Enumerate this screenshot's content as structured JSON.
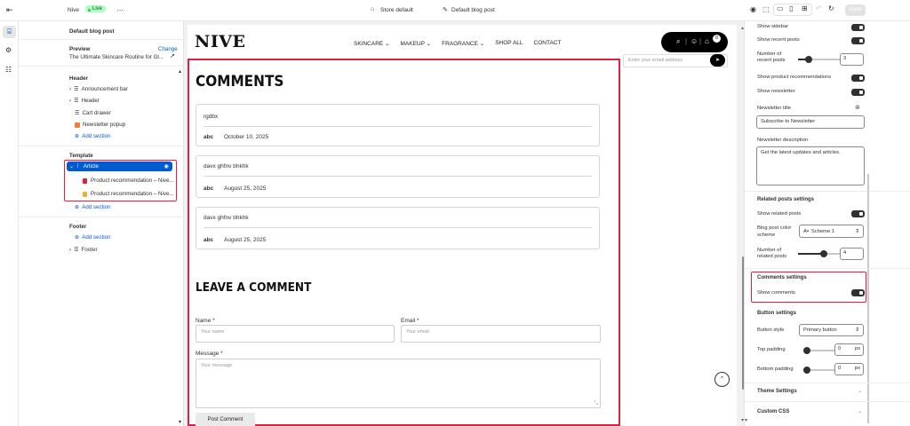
{
  "topbar": {
    "store_name": "Nive",
    "live_badge": "Live",
    "more": "…",
    "store_default": "Store default",
    "template_selector": "Default blog post",
    "save_label": "Save"
  },
  "sidebar": {
    "title": "Default blog post",
    "preview_label": "Preview",
    "change_label": "Change",
    "preview_item": "The Ultimate Skincare Routine for Gl...",
    "header_group": "Header",
    "header_items": [
      "Announcement bar",
      "Header",
      "Cart drawer",
      "Newsletter popup"
    ],
    "add_section": "Add section",
    "template_group": "Template",
    "article_label": "Article",
    "article_blocks": [
      "Product recommendation – Nive...",
      "Product recommendation – Nive..."
    ],
    "footer_group": "Footer",
    "footer_item": "Footer"
  },
  "preview": {
    "logo": "NIVE",
    "nav": [
      "SKINCARE",
      "MAKEUP",
      "FRAGRANCE",
      "SHOP ALL",
      "CONTACT"
    ],
    "cart_count": "0",
    "email_placeholder": "Enter your email address",
    "comments_heading": "COMMENTS",
    "comments": [
      {
        "text": "rgdbx",
        "author": "abc",
        "date": "October 10, 2025"
      },
      {
        "text": "davx ghfnv bhkhk",
        "author": "abc",
        "date": "August 25, 2025"
      },
      {
        "text": "davx ghfnv bhkhk",
        "author": "abc",
        "date": "August 25, 2025"
      }
    ],
    "leave_heading": "LEAVE A COMMENT",
    "name_label": "Name *",
    "name_placeholder": "Your name",
    "email_label": "Email *",
    "email_input_placeholder": "Your email",
    "message_label": "Message *",
    "message_placeholder": "Your message",
    "post_button": "Post Comment"
  },
  "settings": {
    "show_sidebar": "Show sidebar",
    "show_recent_posts": "Show recent posts",
    "number_recent_posts": "Number of recent posts",
    "recent_posts_value": "3",
    "recent_posts_level": 0.25,
    "show_product_recs": "Show product recommendations",
    "show_newsletter": "Show newsletter",
    "newsletter_title_label": "Newsletter title",
    "newsletter_title_value": "Subscribe to Newsletter",
    "newsletter_desc_label": "Newsletter description",
    "newsletter_desc_value": "Get the latest updates and articles.",
    "related_heading": "Related posts settings",
    "show_related": "Show related posts",
    "blog_color_label": "Blog post color scheme",
    "scheme_value": "Scheme 1",
    "number_related": "Number of related posts",
    "related_value": "4",
    "related_level": 0.6,
    "comments_heading": "Comments settings",
    "show_comments": "Show comments",
    "button_heading": "Button settings",
    "button_style_label": "Button style",
    "button_style_value": "Primary button",
    "top_padding_label": "Top padding",
    "top_padding_value": "0",
    "bottom_padding_label": "Bottom padding",
    "bottom_padding_value": "0",
    "px": "px",
    "theme_settings": "Theme Settings",
    "custom_css": "Custom CSS"
  },
  "colors": {
    "accent": "#005bd3",
    "highlight": "#e0203e",
    "live": "#2fc85b"
  }
}
